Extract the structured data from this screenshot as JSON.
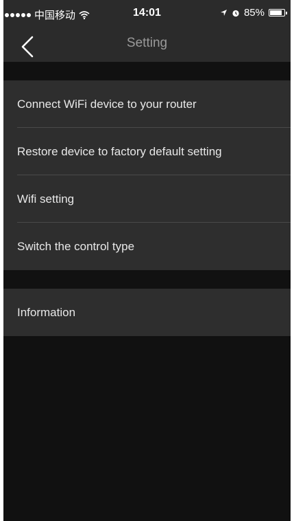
{
  "status_bar": {
    "carrier": "中国移动",
    "time": "14:01",
    "battery": "85%",
    "battery_level": 0.85
  },
  "nav": {
    "title": "Setting",
    "back_icon": "chevron-left-icon"
  },
  "groups": [
    {
      "items": [
        {
          "label": "Connect WiFi device to your router"
        },
        {
          "label": "Restore device to factory default setting"
        },
        {
          "label": "Wifi setting"
        },
        {
          "label": "Switch the control type"
        }
      ]
    },
    {
      "items": [
        {
          "label": "Information"
        }
      ]
    }
  ],
  "colors": {
    "bar_bg": "#2b2b2b",
    "list_bg": "#2e2e2e",
    "page_bg": "#111111",
    "text": "#e8e8e8",
    "title": "#9a9a9a"
  }
}
